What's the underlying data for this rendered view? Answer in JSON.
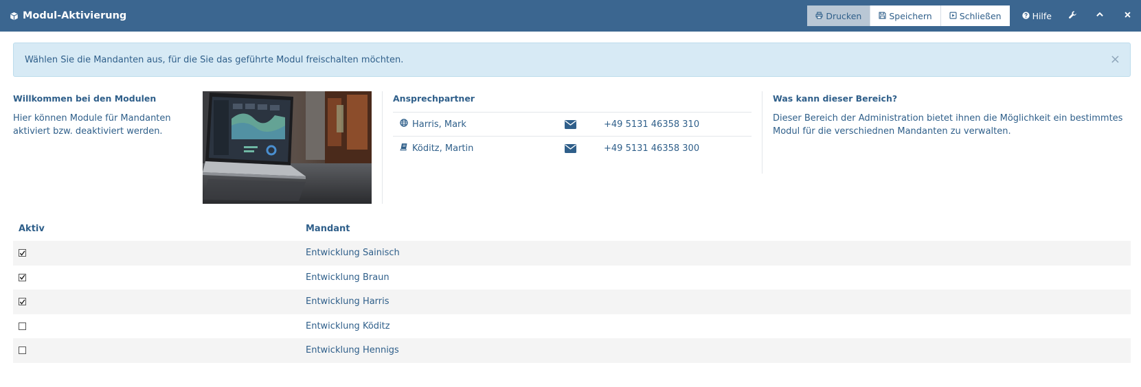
{
  "titlebar": {
    "title": "Modul-Aktivierung",
    "buttons": {
      "print": "Drucken",
      "save": "Speichern",
      "close": "Schließen",
      "help": "Hilfe"
    }
  },
  "alert": {
    "text": "Wählen Sie die Mandanten aus, für die Sie das geführte Modul freischalten möchten.",
    "close_symbol": "×"
  },
  "welcome": {
    "title": "Willkommen bei den Modulen",
    "text": "Hier können Module für Mandanten aktiviert bzw. deaktiviert werden."
  },
  "contacts": {
    "title": "Ansprechpartner",
    "people": [
      {
        "name": "Harris, Mark",
        "icon": "globe-icon",
        "phone": "+49 5131 46358 310"
      },
      {
        "name": "Köditz, Martin",
        "icon": "book-icon",
        "phone": "+49 5131 46358 300"
      }
    ]
  },
  "bereich": {
    "title": "Was kann dieser Bereich?",
    "text": "Dieser Bereich der Administration bietet ihnen die Möglichkeit ein bestimmtes Modul für die verschiednen Mandanten zu verwalten."
  },
  "table": {
    "headers": {
      "aktiv": "Aktiv",
      "mandant": "Mandant"
    },
    "rows": [
      {
        "aktiv": true,
        "mandant": "Entwicklung Sainisch"
      },
      {
        "aktiv": true,
        "mandant": "Entwicklung Braun"
      },
      {
        "aktiv": true,
        "mandant": "Entwicklung Harris"
      },
      {
        "aktiv": false,
        "mandant": "Entwicklung Köditz"
      },
      {
        "aktiv": false,
        "mandant": "Entwicklung Hennigs"
      }
    ]
  },
  "colors": {
    "titlebar_bg": "#3b6690",
    "text": "#2f5f8a",
    "alert_bg": "#d7eaf5",
    "row_stripe": "#f4f4f4"
  }
}
